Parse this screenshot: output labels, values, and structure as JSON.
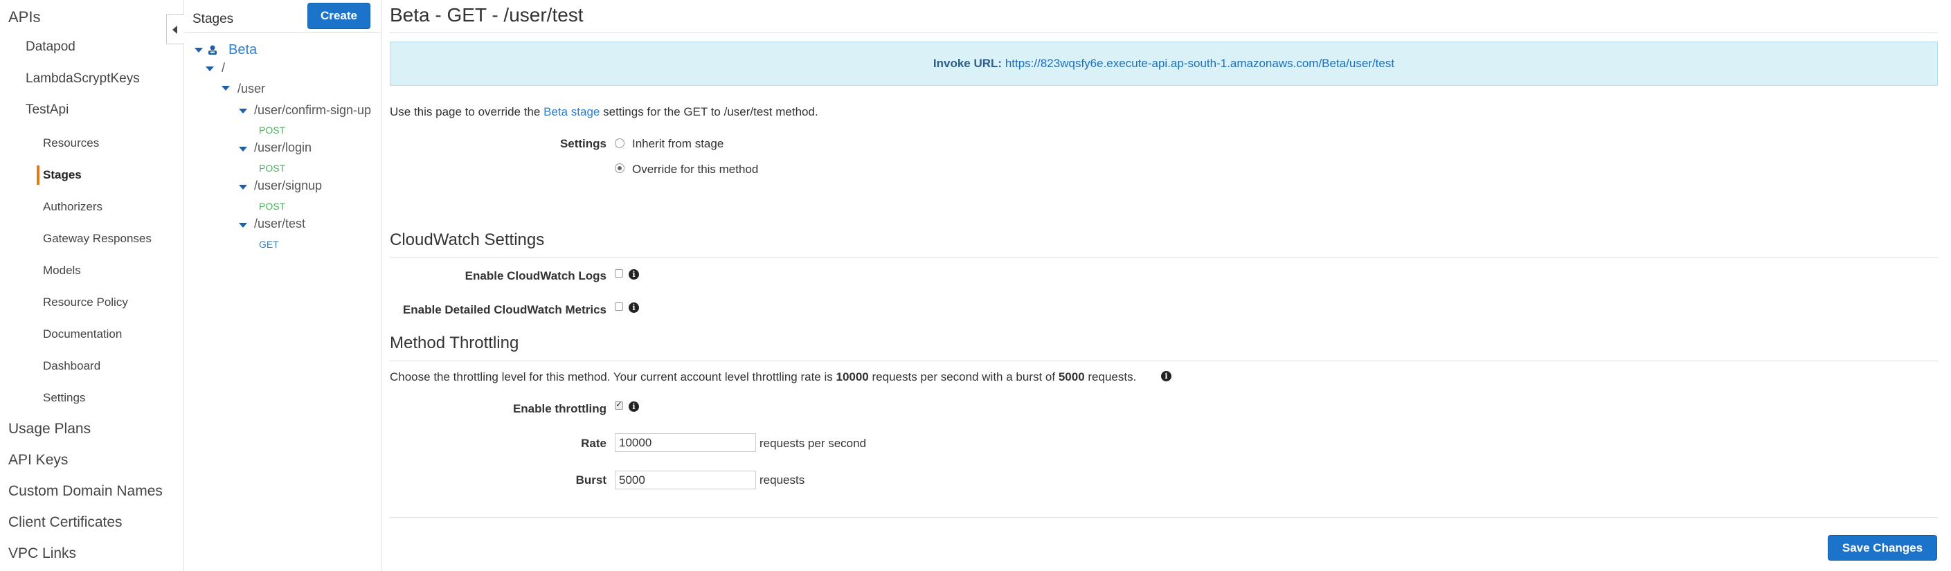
{
  "nav": {
    "top_items": [
      "APIs"
    ],
    "apis": [
      "Datapod",
      "LambdaScryptKeys",
      "TestApi"
    ],
    "testapi_items": [
      "Resources",
      "Stages",
      "Authorizers",
      "Gateway Responses",
      "Models",
      "Resource Policy",
      "Documentation",
      "Dashboard",
      "Settings"
    ],
    "bottom_items": [
      "Usage Plans",
      "API Keys",
      "Custom Domain Names",
      "Client Certificates",
      "VPC Links"
    ],
    "active": "Stages",
    "accent_color": "#e07b1c"
  },
  "stages_panel": {
    "title": "Stages",
    "create_label": "Create",
    "tree": {
      "stage": "Beta",
      "root": "/",
      "user": "/user",
      "children": [
        {
          "path": "/user/confirm-sign-up",
          "method": "POST"
        },
        {
          "path": "/user/login",
          "method": "POST"
        },
        {
          "path": "/user/signup",
          "method": "POST"
        },
        {
          "path": "/user/test",
          "method": "GET"
        }
      ]
    }
  },
  "main": {
    "title": "Beta - GET - /user/test",
    "invoke_label": "Invoke URL:",
    "invoke_url": "https://823wqsfy6e.execute-api.ap-south-1.amazonaws.com/Beta/user/test",
    "override_prefix": "Use this page to override the",
    "override_link": "Beta stage",
    "override_suffix": "settings for the GET to /user/test method.",
    "settings_label": "Settings",
    "settings_options": [
      "Inherit from stage",
      "Override for this method"
    ],
    "settings_selected": "Override for this method",
    "cloudwatch_title": "CloudWatch Settings",
    "cw_logs_label": "Enable CloudWatch Logs",
    "cw_metrics_label": "Enable Detailed CloudWatch Metrics",
    "cw_logs_checked": false,
    "cw_metrics_checked": false,
    "throttling_title": "Method Throttling",
    "throttling_desc_1": "Choose the throttling level for this method. Your current account level throttling rate is",
    "throttling_rate_bold": "10000",
    "throttling_desc_2": "requests per second with a burst of",
    "throttling_burst_bold": "5000",
    "throttling_desc_3": "requests.",
    "enable_throttling_label": "Enable throttling",
    "enable_throttling_checked": true,
    "rate_label": "Rate",
    "rate_value": "10000",
    "rate_unit": "requests per second",
    "burst_label": "Burst",
    "burst_value": "5000",
    "burst_unit": "requests",
    "save_label": "Save Changes",
    "primary_color": "#1b74c9",
    "invoke_bg": "#d9f1f7"
  }
}
